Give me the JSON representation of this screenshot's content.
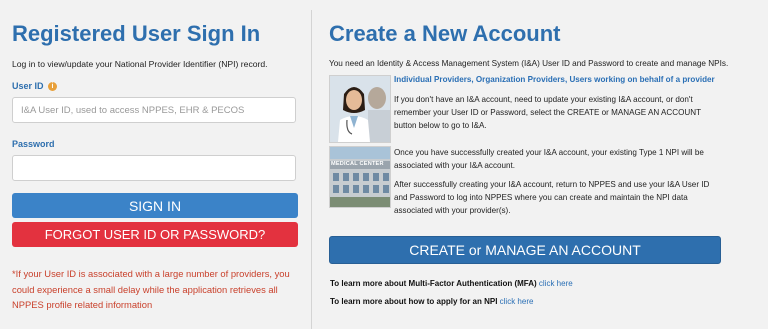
{
  "signin": {
    "title": "Registered User Sign In",
    "subtitle": "Log in to view/update your National Provider Identifier (NPI) record.",
    "userid_label": "User ID",
    "info_icon_glyph": "i",
    "userid_placeholder": "I&A User ID, used to access NPPES, EHR & PECOS",
    "userid_value": "",
    "password_label": "Password",
    "password_value": "",
    "signin_button": "SIGN IN",
    "forgot_button": "FORGOT USER ID OR PASSWORD?",
    "note": "*If your User ID is associated with a large number of providers, you could experience a small delay while the application retrieves all NPPES profile related information"
  },
  "create": {
    "title": "Create a New Account",
    "intro": "You need an Identity & Access Management System (I&A) User ID and Password to create and manage NPIs.",
    "link_individual": "Individual Providers",
    "link_organization": "Organization Providers",
    "link_surrogates": "Users working on behalf of a provider",
    "separator": ", ",
    "para1": "If you don't have an I&A account, need to update your existing I&A account, or don't remember your User ID or Password, select the CREATE or MANAGE AN ACCOUNT button below to go to I&A.",
    "para2": "Once you have successfully created your I&A account, your existing Type 1 NPI will be associated with your I&A account.",
    "para3": "After successfully creating your I&A account, return to NPPES and use your I&A User ID and Password to log into NPPES where you can create and maintain the NPI data associated with your provider(s).",
    "photo_building_sign": "MEDICAL CENTER",
    "manage_button": "CREATE or MANAGE AN ACCOUNT",
    "mfa_text": "To learn more about Multi-Factor Authentication (MFA)",
    "mfa_link": "click here",
    "npi_text": "To learn more about how to apply for an NPI",
    "npi_link": "click here"
  },
  "colors": {
    "heading_blue": "#2e6fae",
    "signin_blue": "#3b83c8",
    "forgot_red": "#e3323f",
    "note_red": "#c9412c",
    "link_blue": "#2a6fb5",
    "info_orange": "#e8a03a",
    "background": "#f2f2f2"
  }
}
